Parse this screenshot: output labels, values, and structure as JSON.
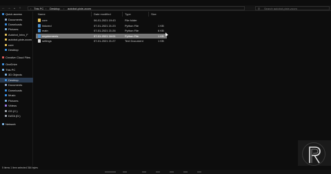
{
  "address": {
    "crumbs": [
      "This PC",
      "Desktop",
      "autobot-pixie-zoom"
    ],
    "search_placeholder": "Search autobot-pixie-zoom"
  },
  "sidebar": {
    "items": [
      {
        "label": "Quick access",
        "icon": "star-icon",
        "color": "#3b8fe0",
        "selected": false
      },
      {
        "label": "Documents",
        "icon": "documents-icon",
        "color": "#8fa8c8",
        "selected": false
      },
      {
        "label": "Downloads",
        "icon": "downloads-icon",
        "color": "#3b8fe0",
        "selected": false
      },
      {
        "label": "Pictures",
        "icon": "pictures-icon",
        "color": "#7ab0e0",
        "selected": false
      },
      {
        "label": "Autobot_Intro_F",
        "icon": "folder-icon",
        "color": "#e8c35a",
        "selected": false
      },
      {
        "label": "autobot-pixie-zoom",
        "icon": "folder-icon",
        "color": "#e8c35a",
        "selected": false
      },
      {
        "label": "core",
        "icon": "folder-icon",
        "color": "#e8c35a",
        "selected": false
      },
      {
        "label": "Desktop",
        "icon": "folder-icon",
        "color": "#3b8fe0",
        "selected": false
      },
      {
        "label": "Creative Cloud Files",
        "icon": "cloud-icon",
        "color": "#e05a5a",
        "selected": false
      },
      {
        "label": "OneDrive",
        "icon": "onedrive-icon",
        "color": "#3b8fe0",
        "selected": false
      },
      {
        "label": "This PC",
        "icon": "computer-icon",
        "color": "#7ab0e0",
        "selected": false
      },
      {
        "label": "3D Objects",
        "icon": "3d-objects-icon",
        "color": "#7ab0e0",
        "selected": false
      },
      {
        "label": "Desktop",
        "icon": "desktop-icon",
        "color": "#3b8fe0",
        "selected": true
      },
      {
        "label": "Documents",
        "icon": "documents-icon",
        "color": "#8fa8c8",
        "selected": false
      },
      {
        "label": "Downloads",
        "icon": "downloads-icon",
        "color": "#3b8fe0",
        "selected": false
      },
      {
        "label": "Music",
        "icon": "music-icon",
        "color": "#3b8fe0",
        "selected": false
      },
      {
        "label": "Pictures",
        "icon": "pictures-icon",
        "color": "#7ab0e0",
        "selected": false
      },
      {
        "label": "Videos",
        "icon": "videos-icon",
        "color": "#9a7ae0",
        "selected": false
      },
      {
        "label": "OS (C:)",
        "icon": "drive-icon",
        "color": "#9aa0a8",
        "selected": false
      },
      {
        "label": "DATA (D:)",
        "icon": "drive-icon",
        "color": "#9aa0a8",
        "selected": false
      },
      {
        "label": "Network",
        "icon": "network-icon",
        "color": "#7ab0e0",
        "selected": false
      }
    ]
  },
  "columns": {
    "name": "Name",
    "date": "Date modified",
    "type": "Type",
    "size": "Size"
  },
  "files": [
    {
      "name": "core",
      "date": "06-01-2021 19:43",
      "type": "File folder",
      "size": "",
      "icon": "folder-icon",
      "color": "#e8c35a",
      "selected": false
    },
    {
      "name": "linkcmd",
      "date": "07-01-2021 21:23",
      "type": "Python File",
      "size": "1 KB",
      "icon": "python-file-icon",
      "color": "#4a8fd0",
      "selected": false
    },
    {
      "name": "main",
      "date": "07-01-2021 21:26",
      "type": "Python File",
      "size": "6 KB",
      "icon": "python-file-icon",
      "color": "#4a8fd0",
      "selected": false
    },
    {
      "name": "requirements",
      "date": "07-01-2021 16:01",
      "type": "Python File",
      "size": "1 KB",
      "icon": "python-file-icon",
      "color": "#4a8fd0",
      "selected": true
    },
    {
      "name": "settings",
      "date": "07-01-2021 21:27",
      "type": "Text Document",
      "size": "1 KB",
      "icon": "text-file-icon",
      "color": "#d8d8d8",
      "selected": false
    }
  ],
  "status": {
    "text": "5 items   1 item selected  364 bytes"
  }
}
